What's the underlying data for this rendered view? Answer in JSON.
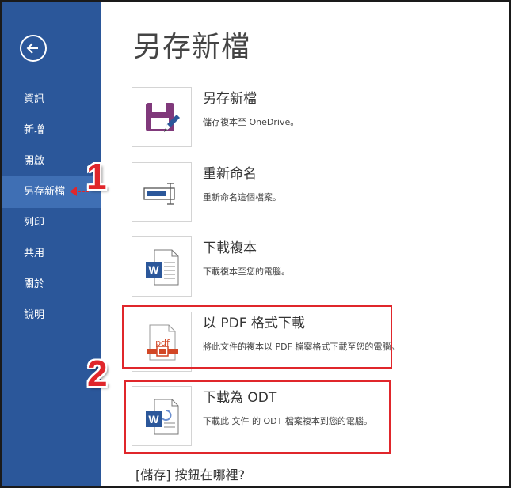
{
  "sidebar": {
    "back_icon": "back-arrow-icon",
    "items": [
      {
        "label": "資訊"
      },
      {
        "label": "新增"
      },
      {
        "label": "開啟"
      },
      {
        "label": "另存新檔",
        "selected": true
      },
      {
        "label": "列印"
      },
      {
        "label": "共用"
      },
      {
        "label": "關於"
      },
      {
        "label": "說明"
      }
    ]
  },
  "main": {
    "title": "另存新檔",
    "options": [
      {
        "title": "另存新檔",
        "desc": "儲存複本至 OneDrive。",
        "icon": "save-floppy-icon"
      },
      {
        "title": "重新命名",
        "desc": "重新命名這個檔案。",
        "icon": "rename-icon"
      },
      {
        "title": "下載複本",
        "desc": "下載複本至您的電腦。",
        "icon": "word-document-icon"
      },
      {
        "title": "以 PDF 格式下載",
        "desc": "將此文件的複本以 PDF 檔案格式下載至您的電腦。",
        "icon": "pdf-icon",
        "pdf_label": "pdf"
      },
      {
        "title": "下載為 ODT",
        "desc": "下載此 文件 的 ODT 檔案複本到您的電腦。",
        "icon": "odt-document-icon"
      }
    ],
    "footer_link": "[儲存] 按鈕在哪裡?"
  },
  "annotations": {
    "step1": "1",
    "step2": "2",
    "color": "#e0262b"
  },
  "colors": {
    "sidebar": "#2b579a",
    "sidebar_selected": "#3f6fb4",
    "save_icon": "#80397b",
    "word_blue": "#2b579a",
    "pdf_orange": "#d24726"
  }
}
